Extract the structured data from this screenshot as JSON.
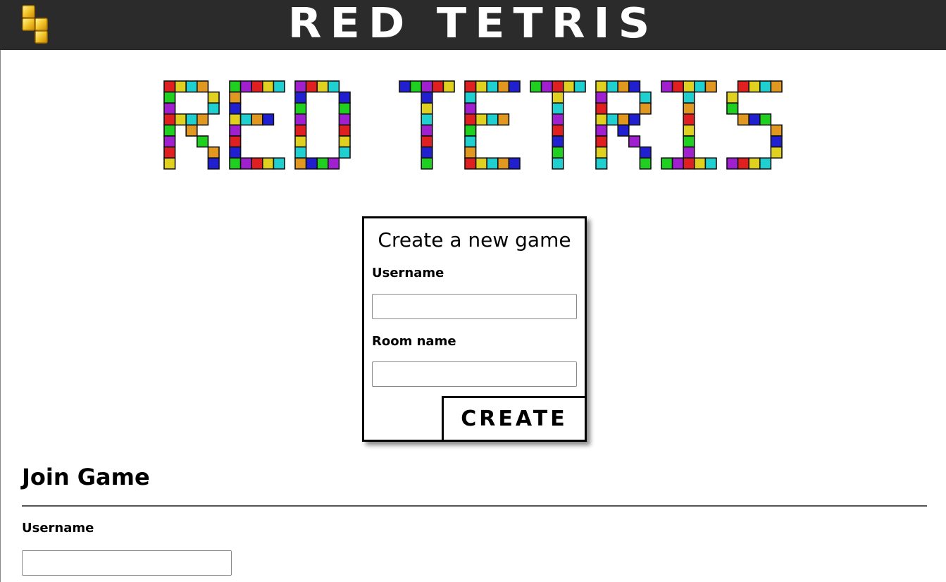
{
  "header": {
    "title": "RED TETRIS",
    "logo_icon": "tetris-blocks-icon",
    "background": "#2b2b2b"
  },
  "banner": {
    "text": "RED TETRIS",
    "palette": [
      "#e02020",
      "#2020d0",
      "#e0d020",
      "#20d020",
      "#20d0d0",
      "#a020d0",
      "#e09820"
    ]
  },
  "create_game": {
    "title": "Create a new game",
    "username_label": "Username",
    "username_value": "",
    "room_label": "Room name",
    "room_value": "",
    "button_label": "CREATE"
  },
  "join_game": {
    "title": "Join Game",
    "username_label": "Username",
    "username_value": ""
  }
}
